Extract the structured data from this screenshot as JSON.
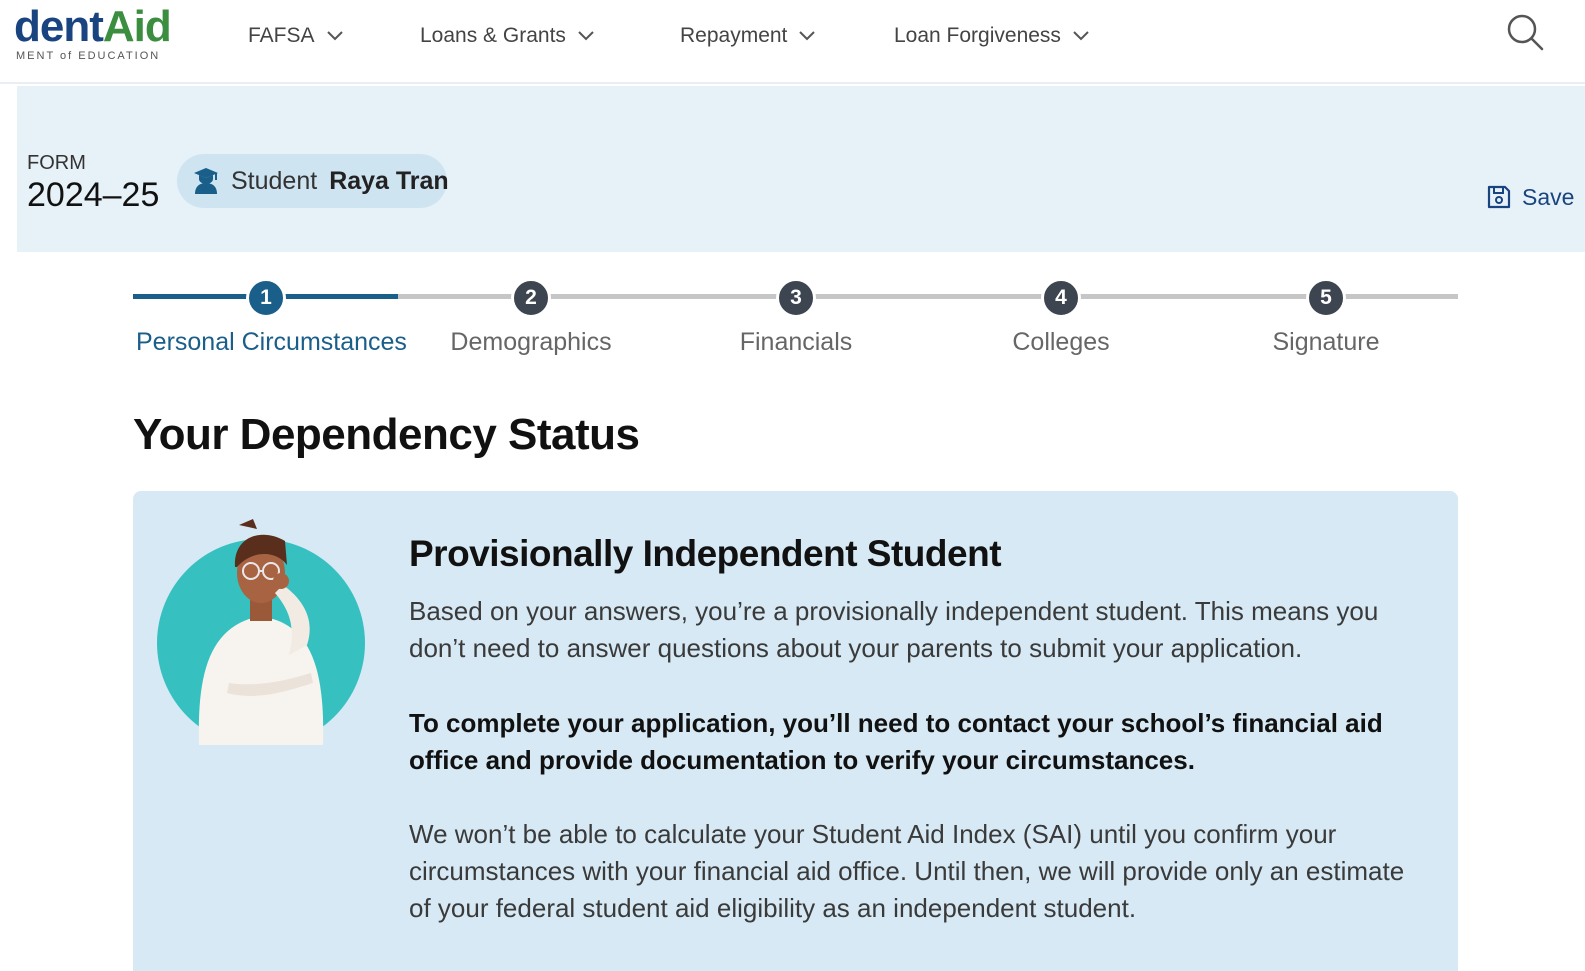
{
  "header": {
    "logo_text_dark": "dent",
    "logo_text_green": "Aid",
    "logo_subtitle": "MENT of EDUCATION",
    "nav": [
      {
        "label": "FAFSA",
        "icon": "chevron-down-icon"
      },
      {
        "label": "Loans & Grants",
        "icon": "chevron-down-icon"
      },
      {
        "label": "Repayment",
        "icon": "chevron-down-icon"
      },
      {
        "label": "Loan Forgiveness",
        "icon": "chevron-down-icon"
      }
    ],
    "search_icon": "search-icon"
  },
  "form": {
    "label": "FORM",
    "year": "2024–25",
    "student_prefix": "Student",
    "student_name": "Raya Tran",
    "save_label": "Save"
  },
  "stepper": {
    "current_step": 1,
    "steps": [
      {
        "number": "1",
        "label": "Personal Circumstances"
      },
      {
        "number": "2",
        "label": "Demographics"
      },
      {
        "number": "3",
        "label": "Financials"
      },
      {
        "number": "4",
        "label": "Colleges"
      },
      {
        "number": "5",
        "label": "Signature"
      }
    ]
  },
  "main": {
    "title": "Your Dependency Status",
    "card": {
      "heading": "Provisionally Independent Student",
      "paragraph1": "Based on your answers, you’re a provisionally independent student. This means you don’t need to answer questions about your parents to submit your application.",
      "paragraph2": "To complete your application, you’ll need to contact your school’s financial aid office and provide documentation to verify your circumstances.",
      "paragraph3": "We won’t be able to calculate your Student Aid Index (SAI) until you confirm your circumstances with your financial aid office. Until then, we will provide only an estimate of your federal student aid eligibility as an independent student."
    }
  },
  "colors": {
    "primary_blue": "#1a5e8a",
    "logo_green": "#3b8d3f",
    "band_bg": "#e7f2f8",
    "card_bg": "#d6e9f4",
    "illustration_teal": "#36c1c0"
  }
}
